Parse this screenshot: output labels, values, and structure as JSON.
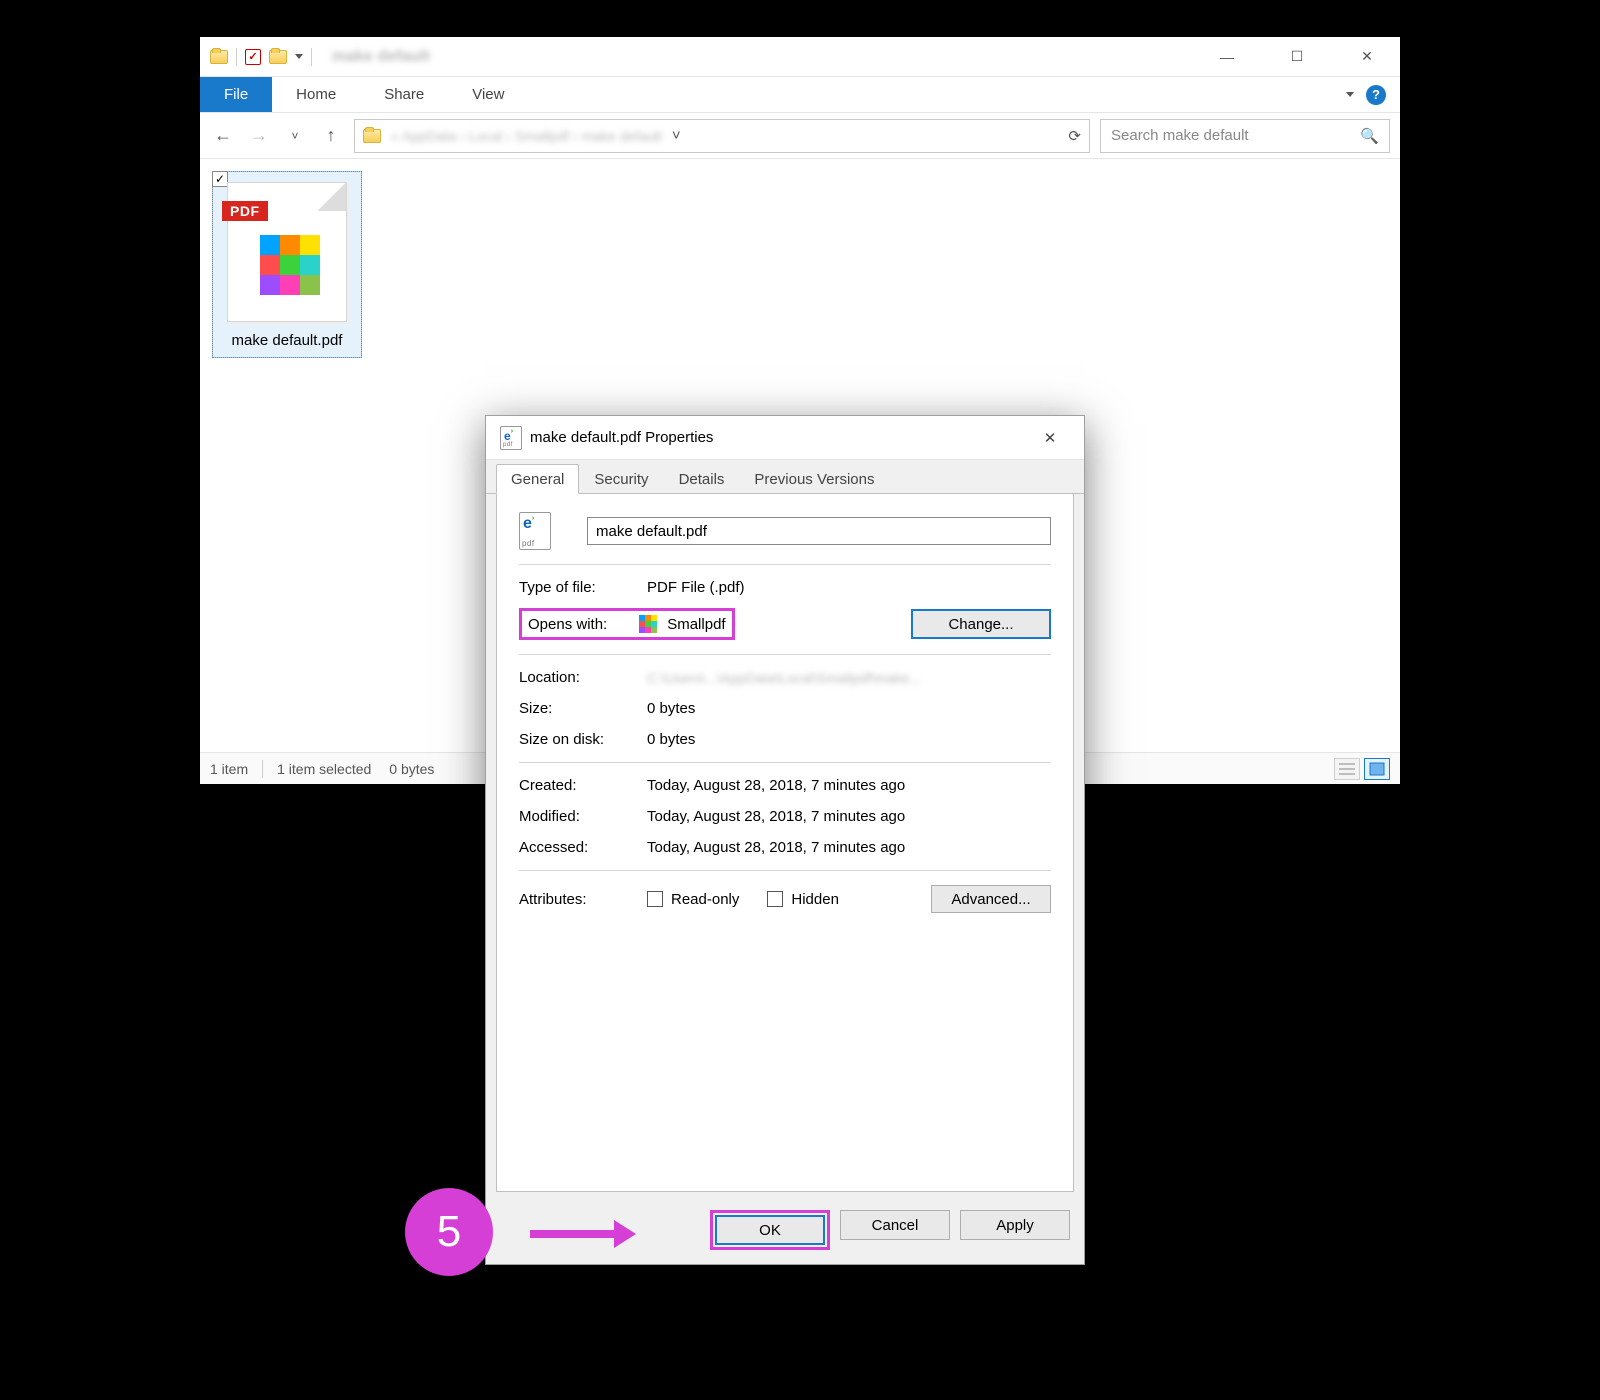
{
  "explorer": {
    "window_title_blur": "make default",
    "tabs": {
      "file": "File",
      "home": "Home",
      "share": "Share",
      "view": "View"
    },
    "path_blur": "«  AppData  ›  Local  ›  Smallpdf  ›  make default",
    "search_placeholder": "Search make default",
    "file_tile": {
      "pdf_badge": "PDF",
      "name": "make default.pdf"
    },
    "status": {
      "count": "1 item",
      "selected": "1 item selected",
      "size": "0 bytes"
    }
  },
  "props": {
    "title": "make default.pdf Properties",
    "tabs": [
      "General",
      "Security",
      "Details",
      "Previous Versions"
    ],
    "filename": "make default.pdf",
    "type_label": "Type of file:",
    "type_value": "PDF File (.pdf)",
    "opens_label": "Opens with:",
    "opens_value": "Smallpdf",
    "change_btn": "Change...",
    "location_label": "Location:",
    "location_blur": "C:\\Users\\...\\AppData\\Local\\Smallpdf\\make...",
    "size_label": "Size:",
    "size_value": "0 bytes",
    "disk_label": "Size on disk:",
    "disk_value": "0 bytes",
    "created_label": "Created:",
    "created_value": "Today, August 28, 2018, 7 minutes ago",
    "modified_label": "Modified:",
    "modified_value": "Today, August 28, 2018, 7 minutes ago",
    "accessed_label": "Accessed:",
    "accessed_value": "Today, August 28, 2018, 7 minutes ago",
    "attributes_label": "Attributes:",
    "readonly_label": "Read-only",
    "hidden_label": "Hidden",
    "advanced_btn": "Advanced...",
    "ok": "OK",
    "cancel": "Cancel",
    "apply": "Apply"
  },
  "step": {
    "number": "5"
  }
}
